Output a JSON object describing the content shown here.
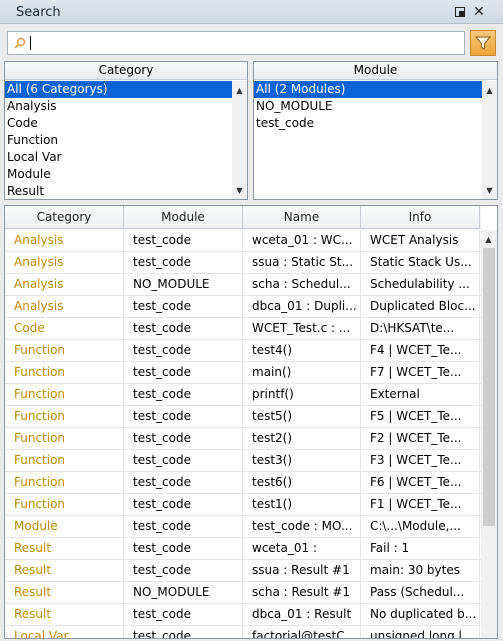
{
  "window": {
    "title": "Search"
  },
  "search": {
    "value": "",
    "placeholder": ""
  },
  "category_list": {
    "header": "Category",
    "items": [
      {
        "label": "All (6 Categorys)",
        "selected": true
      },
      {
        "label": "Analysis",
        "selected": false
      },
      {
        "label": "Code",
        "selected": false
      },
      {
        "label": "Function",
        "selected": false
      },
      {
        "label": "Local Var",
        "selected": false
      },
      {
        "label": "Module",
        "selected": false
      },
      {
        "label": "Result",
        "selected": false
      }
    ]
  },
  "module_list": {
    "header": "Module",
    "items": [
      {
        "label": "All (2 Modules)",
        "selected": true
      },
      {
        "label": "NO_MODULE",
        "selected": false
      },
      {
        "label": "test_code",
        "selected": false
      }
    ]
  },
  "grid": {
    "columns": [
      "Category",
      "Module",
      "Name",
      "Info"
    ],
    "rows": [
      {
        "category": "Analysis",
        "module": "test_code",
        "name": "wceta_01 : WC...",
        "info": "WCET Analysis",
        "name_red": false
      },
      {
        "category": "Analysis",
        "module": "test_code",
        "name": "ssua : Static St...",
        "info": "Static Stack Us...",
        "name_red": false
      },
      {
        "category": "Analysis",
        "module": "NO_MODULE",
        "name": "scha : Schedul...",
        "info": "Schedulability ...",
        "name_red": false
      },
      {
        "category": "Analysis",
        "module": "test_code",
        "name": "dbca_01 : Dupli...",
        "info": "Duplicated Bloc...",
        "name_red": false
      },
      {
        "category": "Code",
        "module": "test_code",
        "name": "WCET_Test.c : ...",
        "info": "D:\\HKSAT\\te...",
        "name_red": false
      },
      {
        "category": "Function",
        "module": "test_code",
        "name": "test4()",
        "info": "F4 | WCET_Te...",
        "name_red": false
      },
      {
        "category": "Function",
        "module": "test_code",
        "name": "main()",
        "info": "F7 | WCET_Te...",
        "name_red": false
      },
      {
        "category": "Function",
        "module": "test_code",
        "name": "printf()",
        "info": "External",
        "name_red": false
      },
      {
        "category": "Function",
        "module": "test_code",
        "name": "test5()",
        "info": "F5 | WCET_Te...",
        "name_red": false
      },
      {
        "category": "Function",
        "module": "test_code",
        "name": "test2()",
        "info": "F2 | WCET_Te...",
        "name_red": false
      },
      {
        "category": "Function",
        "module": "test_code",
        "name": "test3()",
        "info": "F3 | WCET_Te...",
        "name_red": false
      },
      {
        "category": "Function",
        "module": "test_code",
        "name": "test6()",
        "info": "F6 | WCET_Te...",
        "name_red": false
      },
      {
        "category": "Function",
        "module": "test_code",
        "name": "test1()",
        "info": "F1 | WCET_Te...",
        "name_red": false
      },
      {
        "category": "Module",
        "module": "test_code",
        "name": "test_code : MO...",
        "info": "C:\\...\\Module,...",
        "name_red": false
      },
      {
        "category": "Result",
        "module": "test_code",
        "name_red_part": "wceta_01",
        "name_rest": " :",
        "info": "Fail : 1",
        "name_red": true
      },
      {
        "category": "Result",
        "module": "test_code",
        "name_red_part": "ssua",
        "name_rest": " : Result #1",
        "info": "main: 30 bytes",
        "name_red": true
      },
      {
        "category": "Result",
        "module": "NO_MODULE",
        "name_red_part": "scha",
        "name_rest": " : Result #1",
        "info": "Pass (Schedul...",
        "name_red": true
      },
      {
        "category": "Result",
        "module": "test_code",
        "name_red_part": "dbca_01",
        "name_rest": " : Result",
        "info": "No duplicated b...",
        "name_red": true
      },
      {
        "category": "Local Var",
        "module": "test_code",
        "name": "factorial@testC...",
        "info": "unsigned long l...",
        "name_red": false
      }
    ]
  },
  "colors": {
    "category_text": "#c08a00",
    "result_name": "#e02020",
    "selection": "#0a64d8"
  }
}
